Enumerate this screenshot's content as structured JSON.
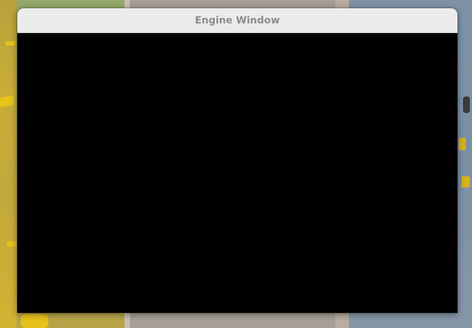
{
  "window": {
    "title": "Engine Window"
  },
  "colors": {
    "titlebar_bg": "#ebebeb",
    "title_text": "#8b8b8b",
    "viewport_bg": "#000000"
  }
}
